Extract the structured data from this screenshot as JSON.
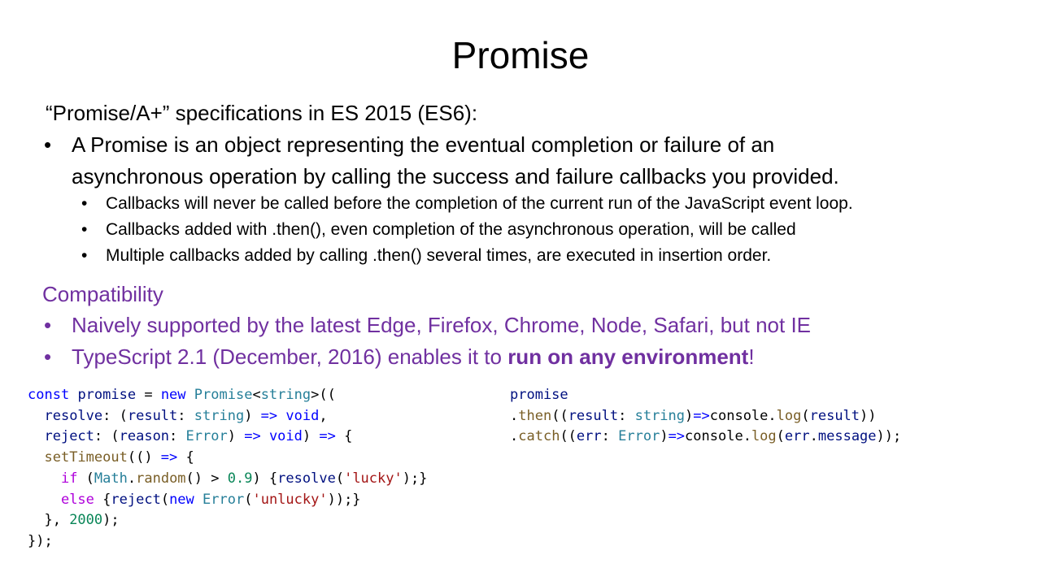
{
  "slide": {
    "title": "Promise",
    "spec_heading": "“Promise/A+” specifications in ES 2015 (ES6):",
    "main_bullet_line1": "A Promise is an object representing the eventual completion or failure of an",
    "main_bullet_line2": "asynchronous operation by calling the success and failure callbacks you provided.",
    "sub_bullets": [
      "Callbacks will never be called before the completion of the current run of the JavaScript event loop.",
      "Callbacks added with .then(), even completion of the asynchronous operation, will be called",
      "Multiple callbacks added by calling .then() several times, are executed in insertion order."
    ],
    "compat_heading": "Compatibility",
    "compat_bullet1": "Naively supported by the latest Edge, Firefox, Chrome, Node, Safari, but not IE",
    "compat_bullet2_pre": "TypeScript 2.1 (December, 2016) enables it to ",
    "compat_bullet2_bold": "run on any environment",
    "compat_bullet2_post": "!",
    "bullet_char": "•"
  },
  "code_left": [
    "const promise = new Promise<string>((",
    "  resolve: (result: string) => void,",
    "  reject: (reason: Error) => void) => {",
    "  setTimeout(() => {",
    "    if (Math.random() > 0.9) {resolve('lucky');}",
    "    else {reject(new Error('unlucky'));}",
    "  }, 2000);",
    "});"
  ],
  "code_right": [
    "promise",
    ".then((result: string)=>console.log(result))",
    ".catch((err: Error)=>console.log(err.message));"
  ]
}
